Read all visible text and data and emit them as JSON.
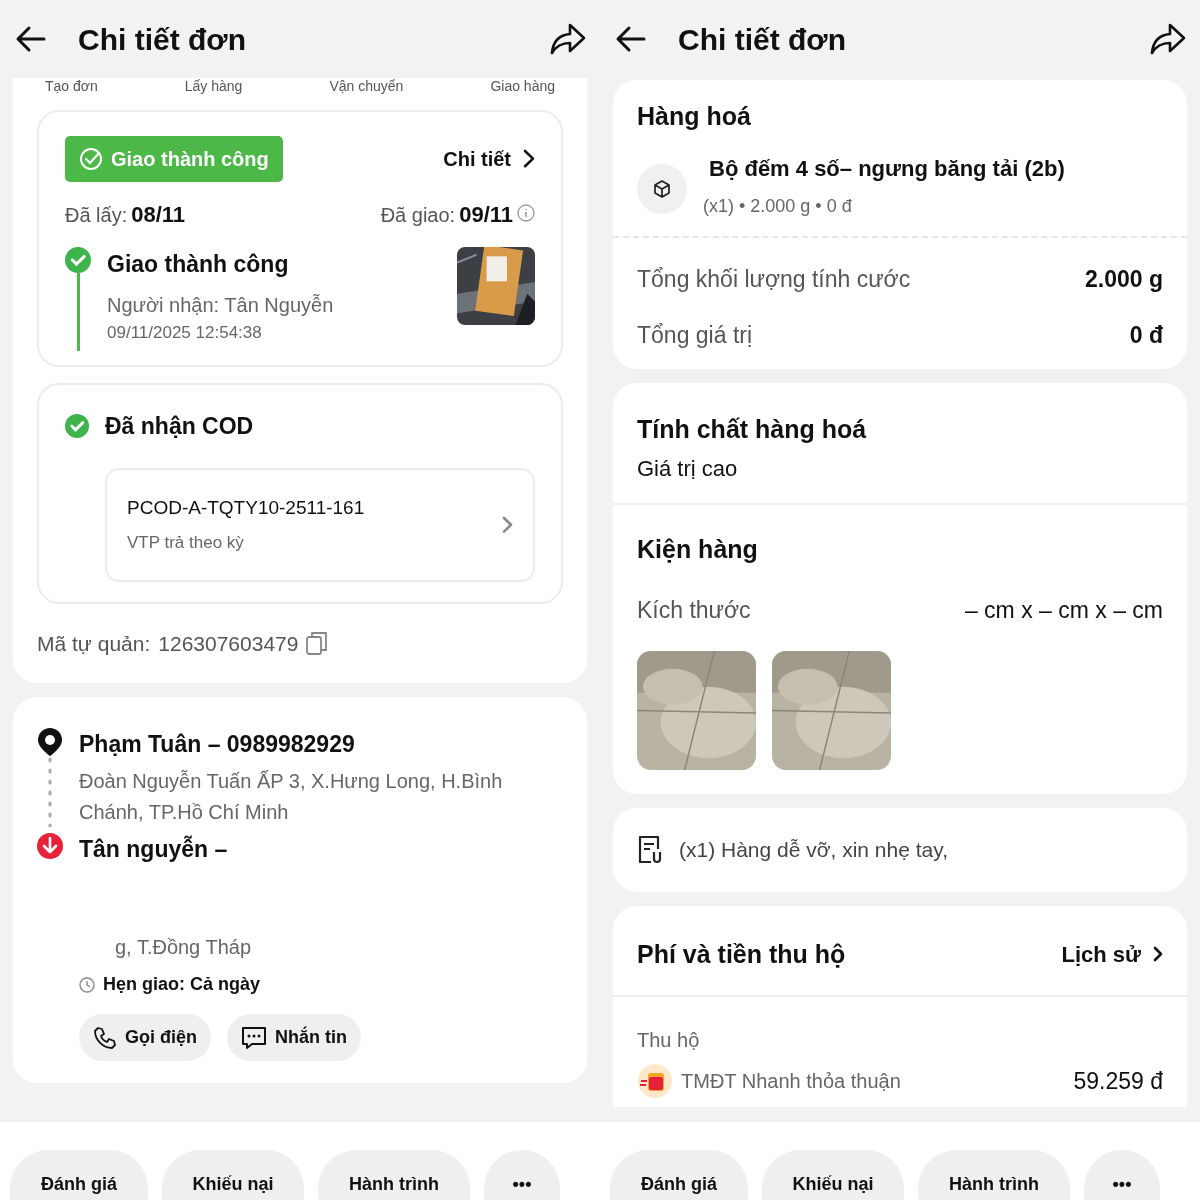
{
  "screens": [
    {
      "header": {
        "title": "Chi tiết đơn"
      },
      "progress_steps": [
        "Tạo đơn",
        "Lấy hàng",
        "Vận chuyển",
        "Giao hàng"
      ],
      "delivery_card": {
        "status_badge": "Giao thành công",
        "detail_link": "Chi tiết",
        "picked_label": "Đã lấy:",
        "picked_date": "08/11",
        "delivered_label": "Đã giao:",
        "delivered_date": "09/11",
        "event": {
          "title": "Giao thành công",
          "receiver": "Người nhận: Tân Nguyễn",
          "time": "09/11/2025 12:54:38"
        }
      },
      "cod_card": {
        "title": "Đã nhận COD",
        "code": "PCOD-A-TQTY10-2511-161",
        "note": "VTP trả theo kỳ"
      },
      "own_code": {
        "label": "Mã tự quản:",
        "value": "126307603479"
      },
      "route": {
        "sender": {
          "name": "Phạm Tuân – 0989982929",
          "address": "Đoàn Nguyễn Tuấn ẤP 3, X.Hưng Long, H.Bình Chánh, TP.Hồ Chí Minh"
        },
        "receiver": {
          "name": "Tân nguyễn –",
          "address": "g, T.Đồng Tháp"
        },
        "appointment": "Hẹn giao: Cả ngày",
        "actions": [
          {
            "kind": "call",
            "label": "Gọi điện"
          },
          {
            "kind": "message",
            "label": "Nhắn tin"
          }
        ]
      },
      "bottom_actions": [
        "Đánh giá",
        "Khiếu nại",
        "Hành trình",
        "•••"
      ]
    },
    {
      "header": {
        "title": "Chi tiết đơn"
      },
      "goods": {
        "title": "Hàng hoá",
        "item": {
          "name": "Bộ đếm 4 số– ngưng băng tải (2b)",
          "meta": "(x1) • 2.000 g • 0 đ"
        },
        "totals": [
          {
            "label": "Tổng khối lượng tính cước",
            "value": "2.000 g"
          },
          {
            "label": "Tổng giá trị",
            "value": "0 đ"
          }
        ]
      },
      "property": {
        "title": "Tính chất hàng hoá",
        "value": "Giá trị cao"
      },
      "package": {
        "title": "Kiện hàng",
        "size_label": "Kích thước",
        "size_value": "– cm x – cm x – cm"
      },
      "note": "(x1) Hàng dễ vỡ, xin nhẹ tay,",
      "fees": {
        "title": "Phí và tiền thu hộ",
        "history_link": "Lịch sử",
        "section": "Thu hộ",
        "rows": [
          {
            "name": "TMĐT Nhanh thỏa thuận",
            "amount": "59.259 đ"
          }
        ]
      },
      "bottom_actions": [
        "Đánh giá",
        "Khiếu nại",
        "Hành trình",
        "•••"
      ]
    }
  ]
}
